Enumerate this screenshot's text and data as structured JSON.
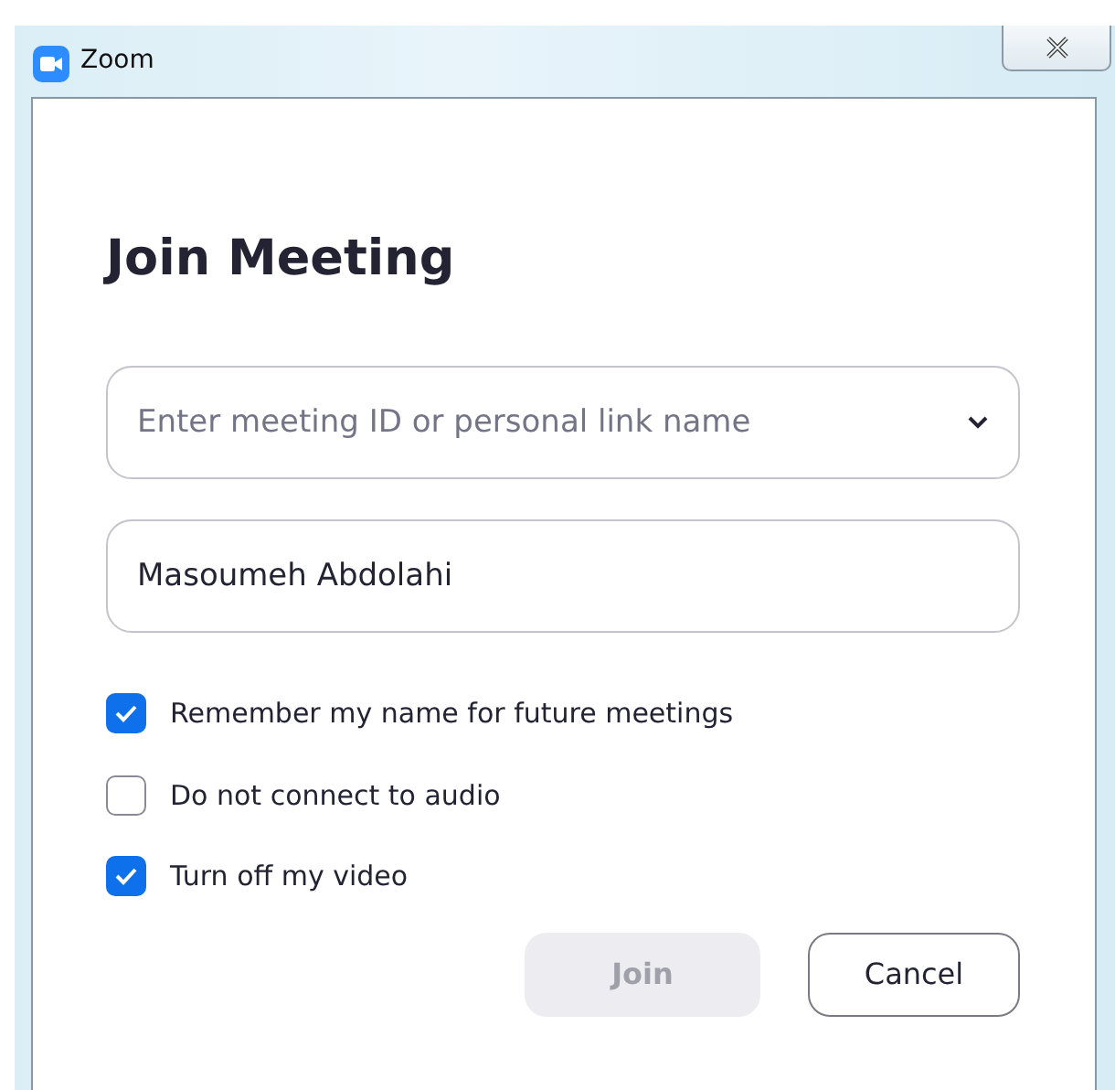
{
  "window": {
    "title": "Zoom"
  },
  "heading": "Join Meeting",
  "meeting_field": {
    "placeholder": "Enter meeting ID or personal link name"
  },
  "name_field": {
    "value": "Masoumeh Abdolahi"
  },
  "options": [
    {
      "label": "Remember my name for future meetings",
      "checked": true
    },
    {
      "label": "Do not connect to audio",
      "checked": false
    },
    {
      "label": "Turn off my video",
      "checked": true
    }
  ],
  "buttons": [
    {
      "label": "Join",
      "disabled": true
    },
    {
      "label": "Cancel",
      "disabled": false
    }
  ]
}
